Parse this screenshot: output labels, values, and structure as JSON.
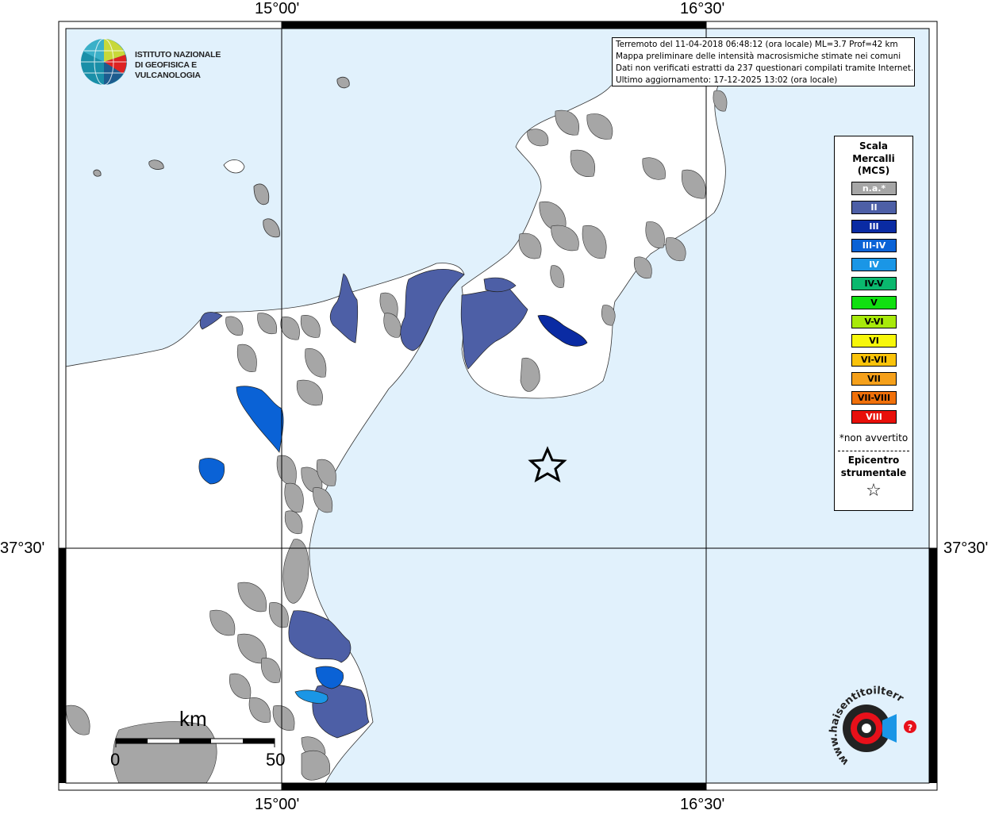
{
  "map": {
    "colors": {
      "sea": "#e1f1fc",
      "land": "#ffffff",
      "na": "#a6a6a6",
      "ii": "#4d5fa6",
      "iii": "#0a2ba3",
      "iii_iv": "#0a62d6",
      "iv": "#1a96e6"
    }
  },
  "coords": {
    "top_left": "15°00'",
    "top_right": "16°30'",
    "bottom_left": "15°00'",
    "bottom_right": "16°30'",
    "lat_left": "37°30'",
    "lat_right": "37°30'"
  },
  "ingv": {
    "line1": "ISTITUTO NAZIONALE",
    "line2": "DI GEOFISICA E VULCANOLOGIA"
  },
  "info": {
    "line1": "Terremoto del 11-04-2018 06:48:12 (ora locale) ML=3.7 Prof=42 km",
    "line2": "Mappa preliminare delle intensità macrosismiche stimate nei comuni",
    "line3": "Dati non verificati estratti da 237 questionari compilati tramite Internet.",
    "line4": "Ultimo aggiornamento: 17-12-2025 13:02 (ora locale)"
  },
  "legend": {
    "title1": "Scala",
    "title2": "Mercalli",
    "title3": "(MCS)",
    "items": [
      {
        "label": "n.a.*",
        "color": "#a6a6a6",
        "text_color": "#ffffff"
      },
      {
        "label": "II",
        "color": "#4d5fa6",
        "text_color": "#ffffff"
      },
      {
        "label": "III",
        "color": "#0a2ba3",
        "text_color": "#ffffff"
      },
      {
        "label": "III-IV",
        "color": "#0a62d6",
        "text_color": "#ffffff"
      },
      {
        "label": "IV",
        "color": "#1a96e6",
        "text_color": "#ffffff"
      },
      {
        "label": "IV-V",
        "color": "#0ab86e",
        "text_color": "#000000"
      },
      {
        "label": "V",
        "color": "#10e010",
        "text_color": "#000000"
      },
      {
        "label": "V-VI",
        "color": "#a8ea0a",
        "text_color": "#000000"
      },
      {
        "label": "VI",
        "color": "#f7f70a",
        "text_color": "#000000"
      },
      {
        "label": "VI-VII",
        "color": "#fac30a",
        "text_color": "#000000"
      },
      {
        "label": "VII",
        "color": "#f5a01a",
        "text_color": "#000000"
      },
      {
        "label": "VII-VIII",
        "color": "#f0700a",
        "text_color": "#000000"
      },
      {
        "label": "VIII",
        "color": "#e8100a",
        "text_color": "#ffffff"
      }
    ],
    "note": "*non avvertito",
    "epicentre1": "Epicentro",
    "epicentre2": "strumentale",
    "star": "☆"
  },
  "scale_bar": {
    "unit": "km",
    "min": "0",
    "max": "50"
  },
  "hst": {
    "text": "www.haisentitoilterremoto.it"
  }
}
